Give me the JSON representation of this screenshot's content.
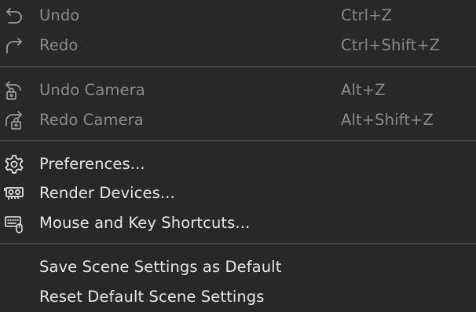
{
  "menu": {
    "undo": {
      "label": "Undo",
      "shortcut": "Ctrl+Z",
      "icon": "undo-icon"
    },
    "redo": {
      "label": "Redo",
      "shortcut": "Ctrl+Shift+Z",
      "icon": "redo-icon"
    },
    "undo_camera": {
      "label": "Undo Camera",
      "shortcut": "Alt+Z",
      "icon": "undo-camera-icon"
    },
    "redo_camera": {
      "label": "Redo Camera",
      "shortcut": "Alt+Shift+Z",
      "icon": "redo-camera-icon"
    },
    "preferences": {
      "label": "Preferences...",
      "icon": "gear-icon"
    },
    "render_devices": {
      "label": "Render Devices...",
      "icon": "gpu-icon"
    },
    "shortcuts": {
      "label": "Mouse and Key Shortcuts...",
      "icon": "keyboard-mouse-icon"
    },
    "save_defaults": {
      "label": "Save Scene Settings as Default"
    },
    "reset_defaults": {
      "label": "Reset Default Scene Settings"
    }
  },
  "colors": {
    "background": "#282828",
    "text": "#e6e6e6",
    "disabled_text": "#8a8a8a",
    "separator": "#474747"
  }
}
